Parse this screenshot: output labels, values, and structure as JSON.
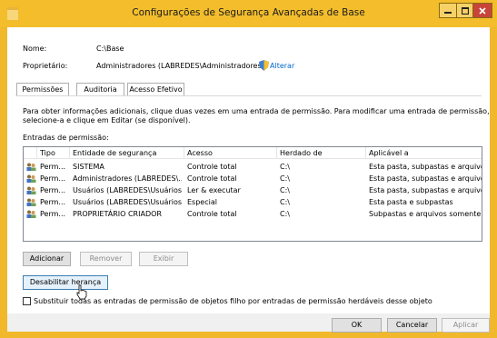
{
  "window": {
    "title": "Configurações de Segurança Avançadas de Base",
    "accent_color": "#f3bd2c"
  },
  "info": {
    "name_label": "Nome:",
    "name_value": "C:\\Base",
    "owner_label": "Proprietário:",
    "owner_value": "Administradores (LABREDES\\Administradores)",
    "change_link": "Alterar"
  },
  "tabs": [
    {
      "label": "Permissões",
      "active": true
    },
    {
      "label": "Auditoria",
      "active": false
    },
    {
      "label": "Acesso Efetivo",
      "active": false
    }
  ],
  "instructions": {
    "line1": "Para obter informações adicionais, clique duas vezes em uma entrada de permissão. Para modificar uma entrada de permissão,",
    "line2": "selecione-a e clique em Editar (se disponível).",
    "entries_label": "Entradas de permissão:"
  },
  "table": {
    "columns": [
      "Tipo",
      "Entidade de segurança",
      "Acesso",
      "Herdado de",
      "Aplicável a"
    ],
    "rows": [
      {
        "type": "Perm...",
        "principal": "SISTEMA",
        "access": "Controle total",
        "inherited": "C:\\",
        "applies": "Esta pasta, subpastas e arquivos"
      },
      {
        "type": "Perm...",
        "principal": "Administradores (LABREDES\\...",
        "access": "Controle total",
        "inherited": "C:\\",
        "applies": "Esta pasta, subpastas e arquivos"
      },
      {
        "type": "Perm...",
        "principal": "Usuários (LABREDES\\Usuários)",
        "access": "Ler & executar",
        "inherited": "C:\\",
        "applies": "Esta pasta, subpastas e arquivos"
      },
      {
        "type": "Perm...",
        "principal": "Usuários (LABREDES\\Usuários)",
        "access": "Especial",
        "inherited": "C:\\",
        "applies": "Esta pasta e subpastas"
      },
      {
        "type": "Perm...",
        "principal": "PROPRIETÁRIO CRIADOR",
        "access": "Controle total",
        "inherited": "C:\\",
        "applies": "Subpastas e arquivos somente"
      }
    ]
  },
  "buttons": {
    "add": "Adicionar",
    "remove": "Remover",
    "view": "Exibir",
    "disable_inheritance": "Desabilitar herança",
    "ok": "OK",
    "cancel": "Cancelar",
    "apply": "Aplicar"
  },
  "replace_checkbox": {
    "label": "Substituir todas as entradas de permissão de objetos filho por entradas de permissão herdáveis desse objeto",
    "checked": false
  }
}
